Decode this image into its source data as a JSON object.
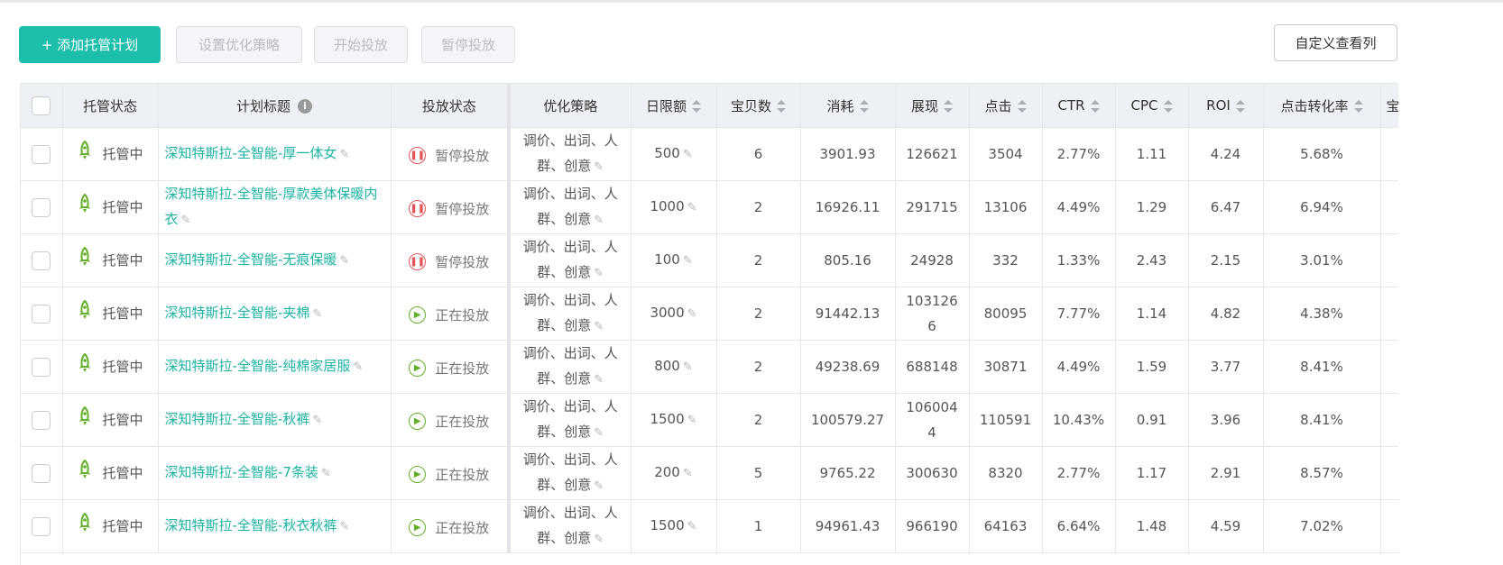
{
  "toolbar": {
    "add": "+ 添加托管计划",
    "strategy": "设置优化策略",
    "start": "开始投放",
    "pause": "暂停投放",
    "custom": "自定义查看列"
  },
  "columns": [
    "托管状态",
    "计划标题",
    "投放状态",
    "优化策略",
    "日限额",
    "宝贝数",
    "消耗",
    "展现",
    "点击",
    "CTR",
    "CPC",
    "ROI",
    "点击转化率",
    "宝"
  ],
  "rows": [
    {
      "managed": "托管中",
      "title": "深知特斯拉-全智能-厚一体女",
      "status": "暂停投放",
      "state": "pause",
      "strategy": "调价、出词、人群、创意",
      "budget": "500",
      "items": "6",
      "cost": "3901.93",
      "impr": "126621",
      "clicks": "3504",
      "ctr": "2.77%",
      "cpc": "1.11",
      "roi": "4.24",
      "cvr": "5.68%"
    },
    {
      "managed": "托管中",
      "title": "深知特斯拉-全智能-厚款美体保暖内衣",
      "status": "暂停投放",
      "state": "pause",
      "strategy": "调价、出词、人群、创意",
      "budget": "1000",
      "items": "2",
      "cost": "16926.11",
      "impr": "291715",
      "clicks": "13106",
      "ctr": "4.49%",
      "cpc": "1.29",
      "roi": "6.47",
      "cvr": "6.94%"
    },
    {
      "managed": "托管中",
      "title": "深知特斯拉-全智能-无痕保暖",
      "status": "暂停投放",
      "state": "pause",
      "strategy": "调价、出词、人群、创意",
      "budget": "100",
      "items": "2",
      "cost": "805.16",
      "impr": "24928",
      "clicks": "332",
      "ctr": "1.33%",
      "cpc": "2.43",
      "roi": "2.15",
      "cvr": "3.01%"
    },
    {
      "managed": "托管中",
      "title": "深知特斯拉-全智能-夹棉",
      "status": "正在投放",
      "state": "play",
      "strategy": "调价、出词、人群、创意",
      "budget": "3000",
      "items": "2",
      "cost": "91442.13",
      "impr": "1031266",
      "clicks": "80095",
      "ctr": "7.77%",
      "cpc": "1.14",
      "roi": "4.82",
      "cvr": "4.38%"
    },
    {
      "managed": "托管中",
      "title": "深知特斯拉-全智能-纯棉家居服",
      "status": "正在投放",
      "state": "play",
      "strategy": "调价、出词、人群、创意",
      "budget": "800",
      "items": "2",
      "cost": "49238.69",
      "impr": "688148",
      "clicks": "30871",
      "ctr": "4.49%",
      "cpc": "1.59",
      "roi": "3.77",
      "cvr": "8.41%"
    },
    {
      "managed": "托管中",
      "title": "深知特斯拉-全智能-秋裤",
      "status": "正在投放",
      "state": "play",
      "strategy": "调价、出词、人群、创意",
      "budget": "1500",
      "items": "2",
      "cost": "100579.27",
      "impr": "1060044",
      "clicks": "110591",
      "ctr": "10.43%",
      "cpc": "0.91",
      "roi": "3.96",
      "cvr": "8.41%"
    },
    {
      "managed": "托管中",
      "title": "深知特斯拉-全智能-7条装",
      "status": "正在投放",
      "state": "play",
      "strategy": "调价、出词、人群、创意",
      "budget": "200",
      "items": "5",
      "cost": "9765.22",
      "impr": "300630",
      "clicks": "8320",
      "ctr": "2.77%",
      "cpc": "1.17",
      "roi": "2.91",
      "cvr": "8.57%"
    },
    {
      "managed": "托管中",
      "title": "深知特斯拉-全智能-秋衣秋裤",
      "status": "正在投放",
      "state": "play",
      "strategy": "调价、出词、人群、创意",
      "budget": "1500",
      "items": "1",
      "cost": "94961.43",
      "impr": "966190",
      "clicks": "64163",
      "ctr": "6.64%",
      "cpc": "1.48",
      "roi": "4.59",
      "cvr": "7.02%"
    }
  ],
  "colors": {
    "accent": "#1dbfac",
    "pause": "#e45458",
    "play": "#62b02a"
  }
}
